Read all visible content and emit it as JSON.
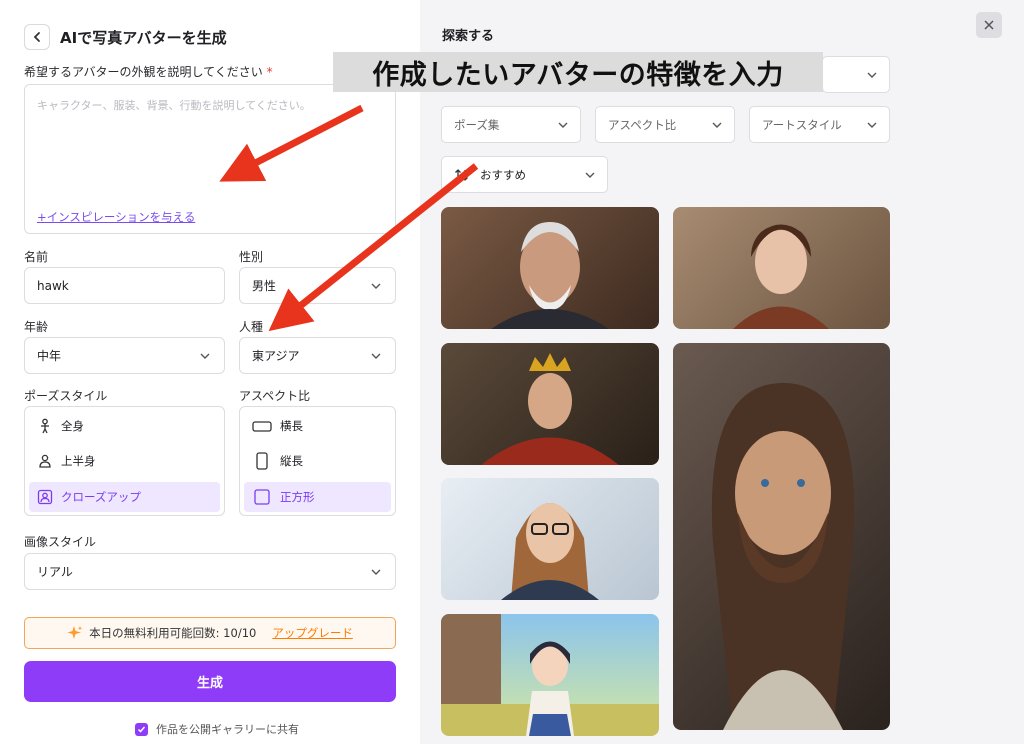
{
  "header": {
    "title": "AIで写真アバターを生成"
  },
  "description": {
    "label": "希望するアバターの外観を説明してください",
    "required_mark": "*",
    "placeholder": "キャラクター、服装、背景、行動を説明してください。",
    "inspiration_link": "+インスピレーションを与える"
  },
  "name": {
    "label": "名前",
    "value": "hawk"
  },
  "gender": {
    "label": "性別",
    "value": "男性"
  },
  "age": {
    "label": "年齢",
    "value": "中年"
  },
  "ethnicity": {
    "label": "人種",
    "value": "東アジア"
  },
  "pose_style": {
    "label": "ポーズスタイル",
    "options": [
      "全身",
      "上半身",
      "クローズアップ"
    ],
    "selected": "クローズアップ"
  },
  "aspect_ratio": {
    "label": "アスペクト比",
    "options": [
      "横長",
      "縦長",
      "正方形"
    ],
    "selected": "正方形"
  },
  "image_style": {
    "label": "画像スタイル",
    "value": "リアル"
  },
  "quota": {
    "text": "本日の無料利用可能回数: 10/10",
    "upgrade": "アップグレード"
  },
  "generate_button": "生成",
  "share": {
    "label": "作品を公開ギャラリーに共有",
    "checked": true
  },
  "explore": {
    "title": "探索する",
    "filters": [
      "ポーズ集",
      "アスペクト比",
      "アートスタイル"
    ],
    "sort": "おすすめ"
  },
  "annotation": {
    "text": "作成したいアバターの特徴を入力"
  },
  "colors": {
    "accent": "#8e3cf7",
    "arrow": "#e8341c",
    "quota_border": "#f3a45a",
    "upgrade": "#ff7a00"
  }
}
